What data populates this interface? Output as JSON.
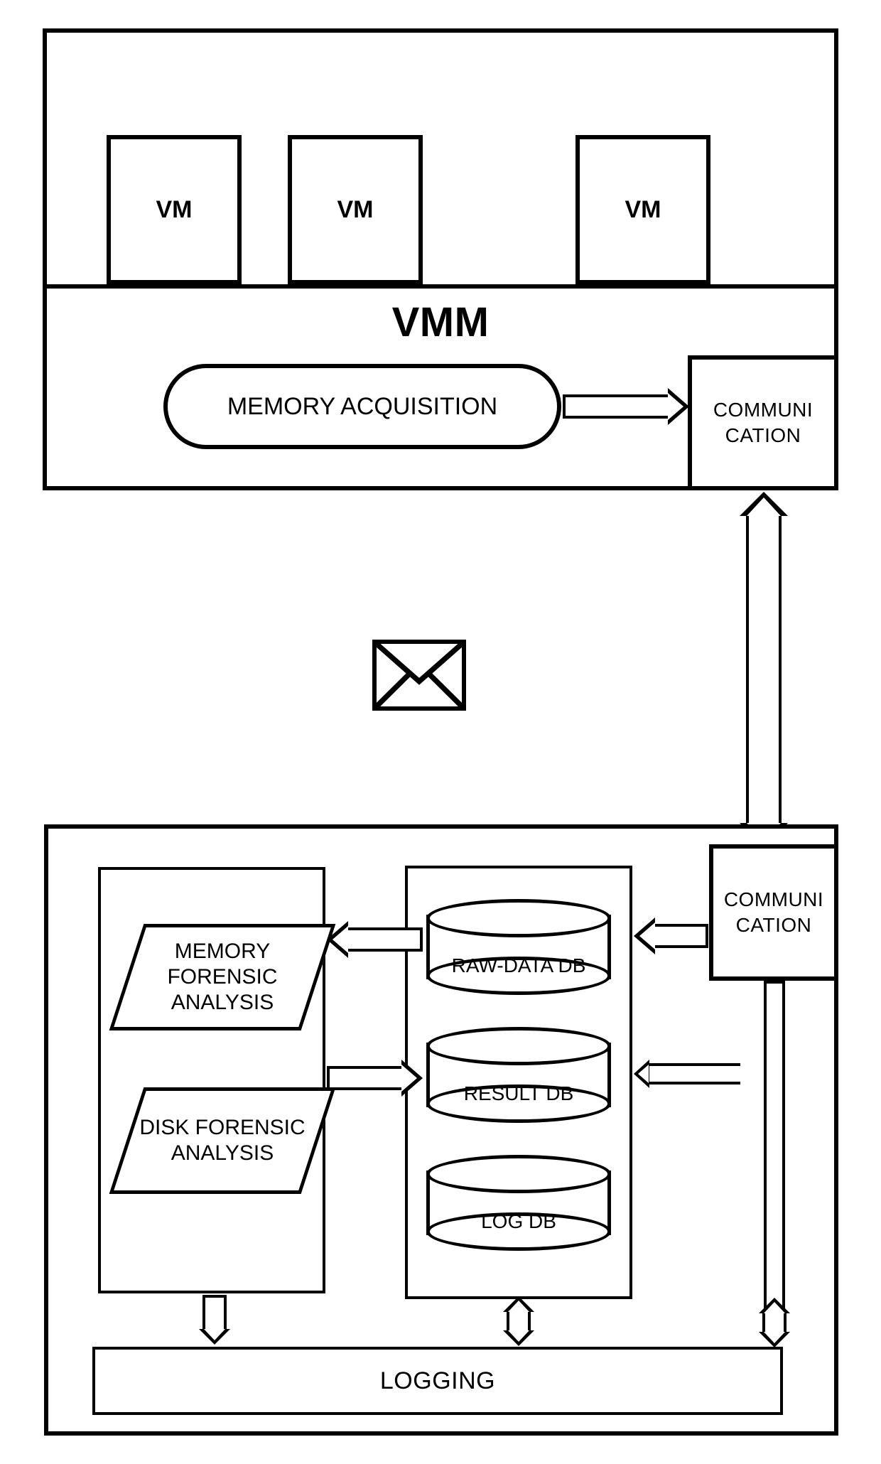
{
  "top": {
    "vm_label": "VM",
    "vmm_title": "VMM",
    "memory_acq": "MEMORY ACQUISITION",
    "communication_top": "COMMUNI\nCATION"
  },
  "bottom": {
    "communication_bottom": "COMMUNI\nCATION",
    "memory_forensic": "MEMORY FORENSIC ANALYSIS",
    "disk_forensic": "DISK FORENSIC ANALYSIS",
    "db_raw": "RAW-DATA DB",
    "db_result": "RESULT DB",
    "db_log": "LOG DB",
    "logging": "LOGGING"
  }
}
